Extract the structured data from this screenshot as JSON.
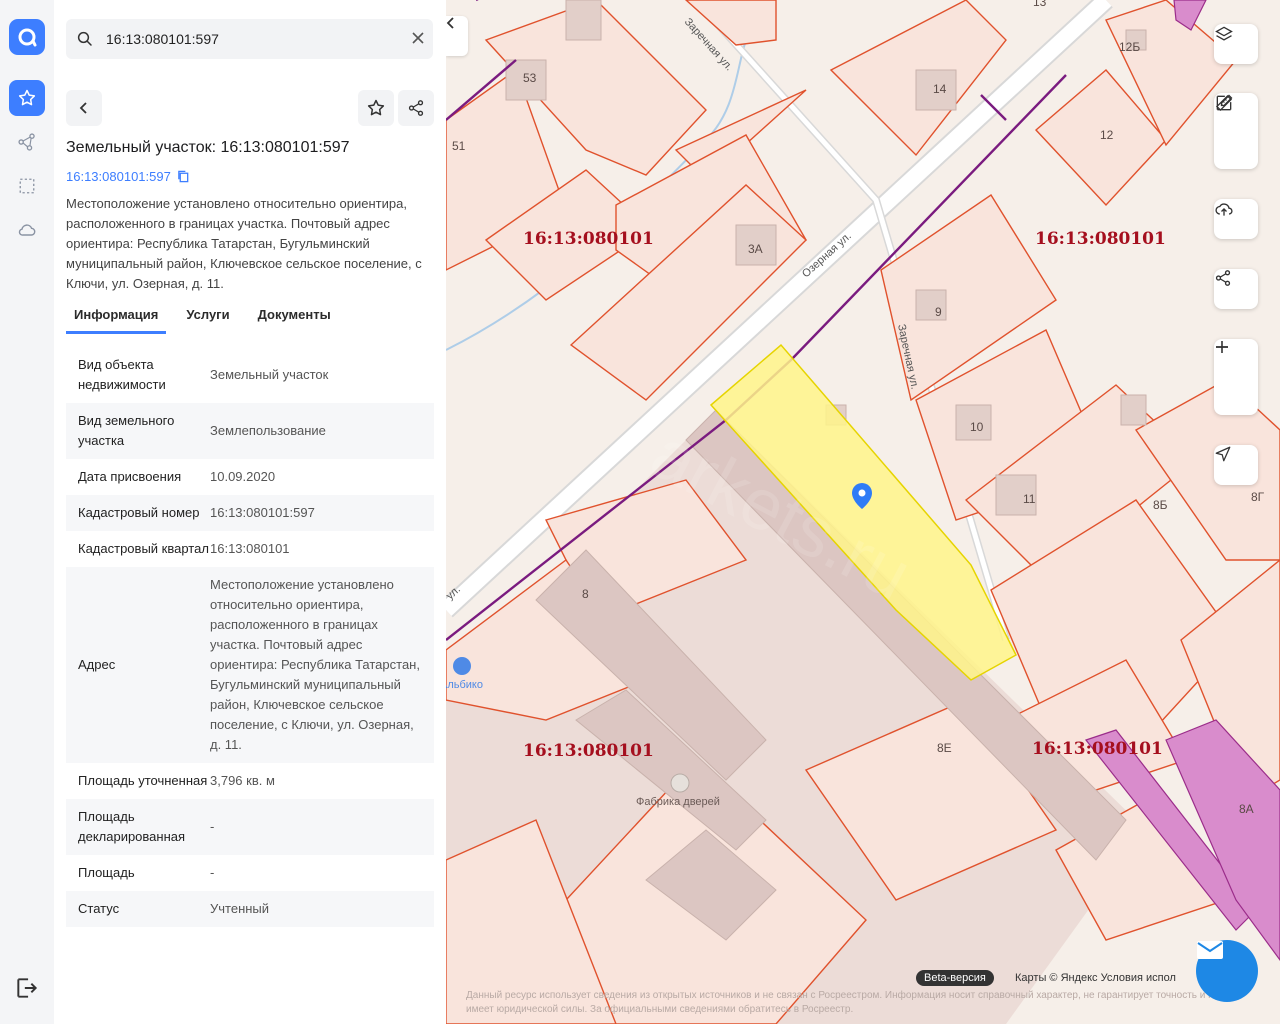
{
  "search": {
    "value": "16:13:080101:597"
  },
  "object": {
    "title": "Земельный участок: 16:13:080101:597",
    "cad_number": "16:13:080101:597",
    "description": "Местоположение установлено относительно ориентира, расположенного в границах участка. Почтовый адрес ориентира: Республика Татарстан, Бугульминский муниципальный район, Ключевское сельское поселение, с Ключи, ул. Озерная, д. 11."
  },
  "tabs": [
    {
      "label": "Информация"
    },
    {
      "label": "Услуги"
    },
    {
      "label": "Документы"
    }
  ],
  "rows": [
    {
      "key": "Вид объекта недвижимости",
      "value": "Земельный участок"
    },
    {
      "key": "Вид земельного участка",
      "value": "Землепользование"
    },
    {
      "key": "Дата присвоения",
      "value": "10.09.2020"
    },
    {
      "key": "Кадастровый номер",
      "value": "16:13:080101:597"
    },
    {
      "key": "Кадастровый квартал",
      "value": "16:13:080101"
    },
    {
      "key": "Адрес",
      "value": "Местоположение установлено относительно ориентира, расположенного в границах участка. Почтовый адрес ориентира: Республика Татарстан, Бугульминский муниципальный район, Ключевское сельское поселение, с Ключи, ул. Озерная, д. 11."
    },
    {
      "key": "Площадь уточненная",
      "value": "3,796 кв. м"
    },
    {
      "key": "Площадь декларированная",
      "value": "-"
    },
    {
      "key": "Площадь",
      "value": "-"
    },
    {
      "key": "Статус",
      "value": "Учтенный"
    }
  ],
  "map": {
    "quarter_labels": [
      "16:13:080101",
      "16:13:080101",
      "16:13:080101",
      "16:13:080101"
    ],
    "house_numbers": [
      "53",
      "51",
      "13",
      "14",
      "12Б",
      "12",
      "3А",
      "9",
      "10",
      "11",
      "8Б",
      "8Г",
      "8",
      "8Е",
      "8А"
    ],
    "streets": [
      "Заречная ул.",
      "Озерная ул.",
      "Заречная ул.",
      "ул."
    ],
    "pois": [
      "Фабрика дверей",
      "Альбико"
    ],
    "watermark": "arkets.ru",
    "beta": "Beta-версия",
    "attribution": "Карты © Яндекс   Условия испол",
    "disclaimer": "Данный ресурс использует сведения из открытых источников и не связан с Росреестром. Информация носит справочный характер, не гарантирует точность и не имеет юридической силы. За официальными сведениями обратитесь в Росреестр."
  },
  "colors": {
    "accent": "#3d7eff",
    "parcel_border": "#e0522d",
    "selected": "#fff48a",
    "quarter_label": "#a50f1e"
  }
}
